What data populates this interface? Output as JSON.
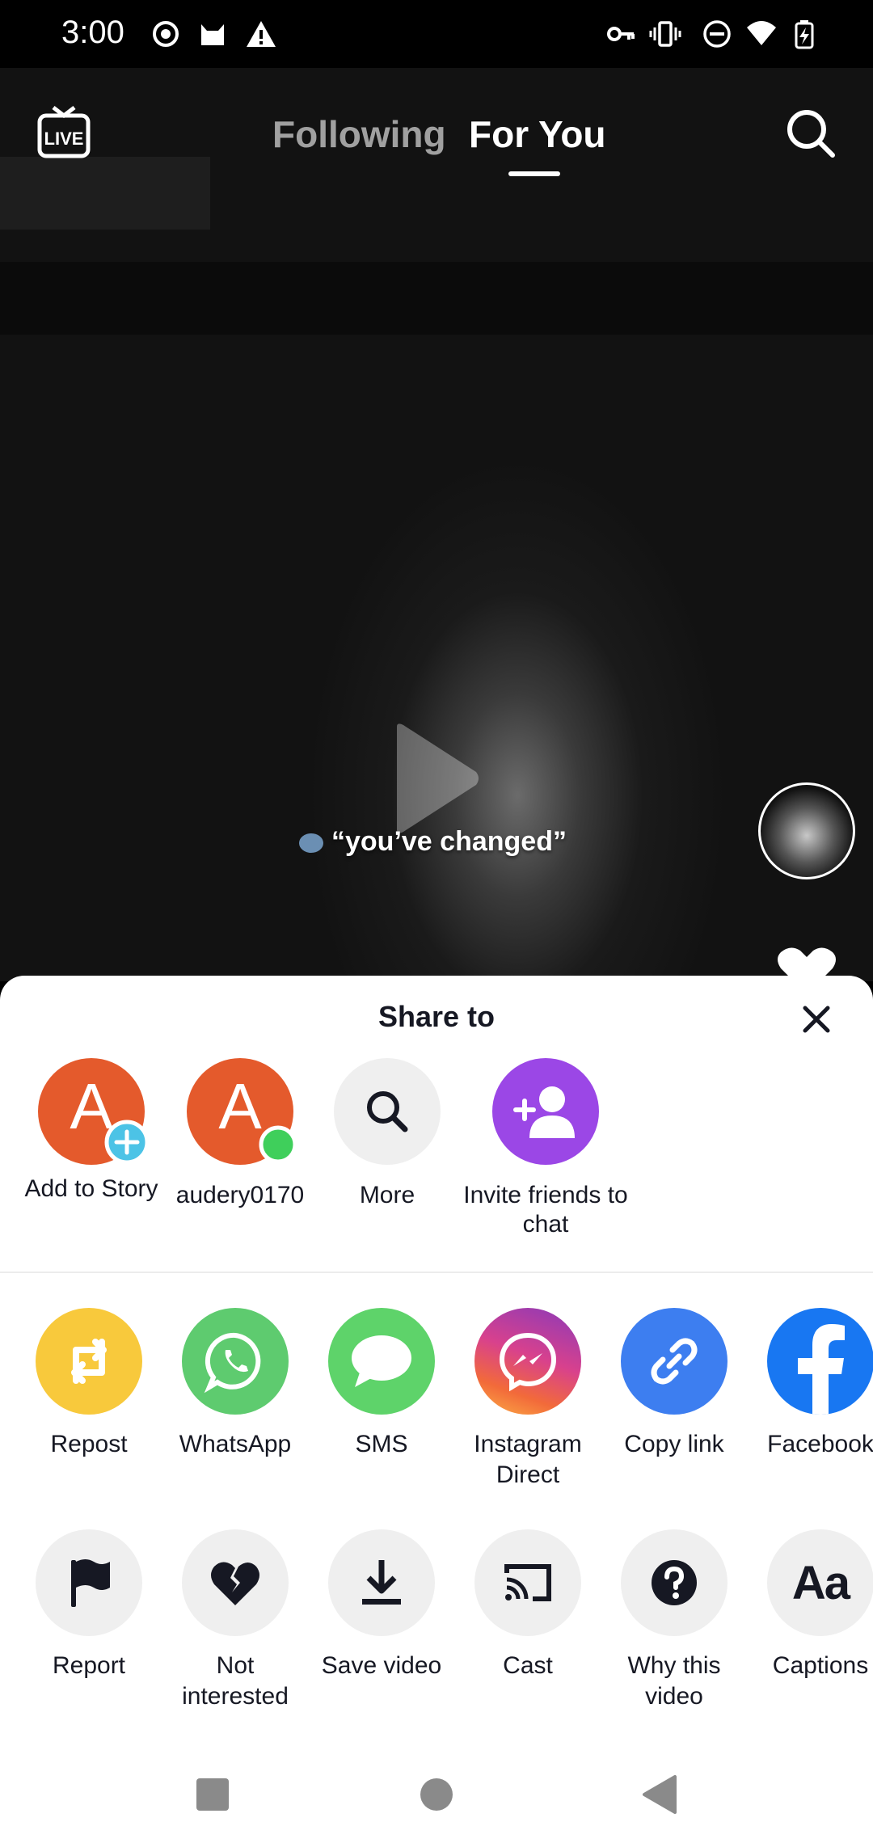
{
  "status_bar": {
    "time": "3:00"
  },
  "top_nav": {
    "tab_following": "Following",
    "tab_for_you": "For You"
  },
  "video": {
    "caption": "“you’ve changed”"
  },
  "share_sheet": {
    "title": "Share to",
    "contacts": [
      {
        "label": "Add to Story",
        "initial": "A"
      },
      {
        "label": "audery0170",
        "initial": "A"
      },
      {
        "label": "More"
      },
      {
        "label": "Invite friends to chat"
      }
    ],
    "apps": [
      {
        "label": "Repost",
        "color": "#f8c93c"
      },
      {
        "label": "WhatsApp",
        "color": "#5ecb6f"
      },
      {
        "label": "SMS",
        "color": "#5ed36a"
      },
      {
        "label": "Instagram Direct",
        "color": "#d8418d"
      },
      {
        "label": "Copy link",
        "color": "#3d7ef0"
      },
      {
        "label": "Facebook",
        "color": "#1877f2"
      }
    ],
    "actions": [
      {
        "label": "Report"
      },
      {
        "label": "Not interested"
      },
      {
        "label": "Save video"
      },
      {
        "label": "Cast"
      },
      {
        "label": "Why this video"
      },
      {
        "label": "Captions"
      }
    ]
  },
  "colors": {
    "accent_orange": "#e45a2c",
    "accent_purple": "#9b47e6",
    "story_plus": "#4cc3e6",
    "online_green": "#3fcf5b"
  }
}
